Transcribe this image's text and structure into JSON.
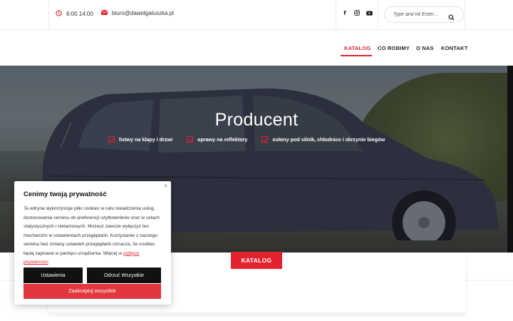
{
  "topbar": {
    "hours": "6:00 14:00",
    "email": "biuro@dawidgaluszka.pl",
    "social": [
      "f",
      "instagram-icon",
      "youtube-icon"
    ],
    "search_placeholder": "Type and hit Enter..."
  },
  "nav": {
    "items": [
      {
        "label": "KATALOG",
        "active": true
      },
      {
        "label": "CO ROBIMY",
        "active": false
      },
      {
        "label": "O NAS",
        "active": false
      },
      {
        "label": "KONTAKT",
        "active": false
      }
    ]
  },
  "hero": {
    "title": "Producent",
    "features": [
      "listwy na klapy i drzwi",
      "oprawy na reflektory",
      "osłony pod silnik, chłodnice i skrzynie biegów"
    ]
  },
  "content": {
    "katalog_button": "KATALOG"
  },
  "cookie": {
    "close": "×",
    "title": "Cenimy twoją prywatność",
    "body": "Ta witryna wykorzystuje pliki cookies w celu świadczenia usług, dostosowania serwisu do preferencji użytkowników oraz w celach statystycznych i reklamowych. Możesz zawsze wyłączyć ten mechanizm w ustawieniach przeglądarki. Korzystanie z naszego serwisu bez zmiany ustawień przeglądarki oznacza, że cookies będą zapisane w pamięci urządzenia. Więcej w ",
    "link": "polityce prywatności",
    "settings_button": "Ustawienia",
    "reject_button": "Odrzuć Wszystkie",
    "accept_button": "Zaakceptuj wszystkie"
  },
  "colors": {
    "accent": "#e2232f",
    "dark_button": "#111111"
  }
}
